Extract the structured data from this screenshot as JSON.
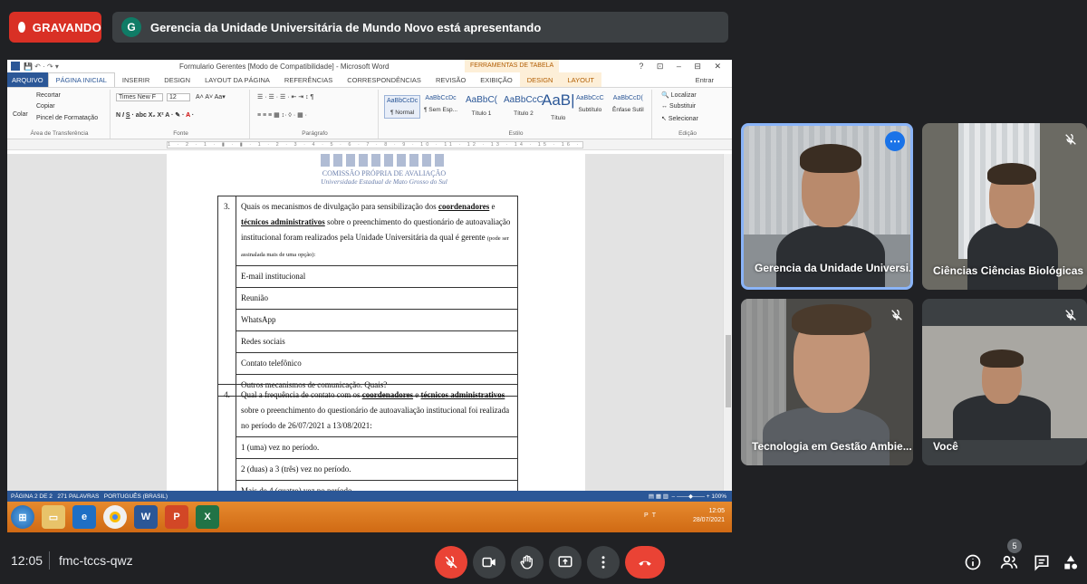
{
  "top": {
    "recording_label": "GRAVANDO",
    "presenter_initial": "G",
    "presenting_text": "Gerencia da Unidade Universitária de Mundo Novo está apresentando"
  },
  "word": {
    "title": "Formulario Gerentes [Modo de Compatibilidade] - Microsoft Word",
    "tool_tab": "FERRAMENTAS DE TABELA",
    "window_buttons": "? ⊡ – ⊟ ✕",
    "tabs": [
      "ARQUIVO",
      "PÁGINA INICIAL",
      "INSERIR",
      "DESIGN",
      "LAYOUT DA PÁGINA",
      "REFERÊNCIAS",
      "CORRESPONDÊNCIAS",
      "REVISÃO",
      "EXIBIÇÃO",
      "DESIGN",
      "LAYOUT"
    ],
    "signin": "Entrar",
    "ribbon": {
      "clipboard": {
        "paste": "Colar",
        "cut": "Recortar",
        "copy": "Copiar",
        "format_painter": "Pincel de Formatação",
        "label": "Área de Transferência"
      },
      "font": {
        "name": "Times New F",
        "size": "12",
        "label": "Fonte"
      },
      "paragraph": {
        "label": "Parágrafo"
      },
      "styles": {
        "label": "Estilo",
        "items": [
          {
            "sample": "AaBbCcDc",
            "name": "¶ Normal"
          },
          {
            "sample": "AaBbCcDc",
            "name": "¶ Sem Esp..."
          },
          {
            "sample": "AaBbC(",
            "name": "Título 1"
          },
          {
            "sample": "AaBbCcC",
            "name": "Título 2"
          },
          {
            "sample": "AaB|",
            "name": "Título"
          },
          {
            "sample": "AaBbCcC",
            "name": "Subtítulo"
          },
          {
            "sample": "AaBbCcD(",
            "name": "Ênfase Sutil"
          }
        ]
      },
      "editing": {
        "find": "Localizar",
        "replace": "Substituir",
        "select": "Selecionar",
        "label": "Edição"
      }
    },
    "ruler": "1 · 2 · 1 · ▮ · ▮ · 1 · 2 · 3 · 4 · 5 · 6 · 7 · 8 · 9 · 10 · 11 · 12 · 13 · 14 · 15 · 16 · 17",
    "logo_subtitle1": "COMISSÃO PRÓPRIA DE AVALIAÇÃO",
    "logo_subtitle2": "Universidade Estadual de Mato Grosso do Sul",
    "q3": {
      "number": "3.",
      "text_a": "Quais os mecanismos de divulgação para sensibilização dos ",
      "bold1": "coordenadores",
      "text_b": " e ",
      "bold2": "técnicos administrativos",
      "text_c": " sobre o preenchimento do questionário de autoavaliação institucional foram realizados pela Unidade Universitária da qual é gerente ",
      "note": "(pode ser assinalada mais de uma opção):",
      "options": [
        "E-mail institucional",
        "Reunião",
        "WhatsApp",
        "Redes sociais",
        "Contato telefônico",
        "Outros mecanismos de comunicação. Quais?"
      ]
    },
    "q4": {
      "number": "4.",
      "text_a": "Qual a frequência de contato com os ",
      "bold1": "coordenadores",
      "text_b": " e ",
      "bold2": "técnicos administrativos",
      "text_c": " sobre o preenchimento do questionário de autoavaliação institucional foi realizada no período de 26/07/2021 a 13/08/2021:",
      "options": [
        "1 (uma) vez no período.",
        "2 (duas) a 3 (três) vez no período.",
        "Mais de 4 (quatro) vez no período."
      ]
    },
    "status": {
      "page": "PÁGINA 2 DE 2",
      "words": "271 PALAVRAS",
      "lang": "PORTUGUÊS (BRASIL)",
      "zoom": "100%"
    },
    "taskbar": {
      "lang": "PT",
      "time": "12:05",
      "date": "28/07/2021"
    }
  },
  "participants": [
    {
      "name": "Gerencia da Unidade Universi..."
    },
    {
      "name": "Ciências Ciências Biológicas ..."
    },
    {
      "name": "Tecnologia em Gestão Ambie..."
    },
    {
      "name": "Você"
    }
  ],
  "bottom": {
    "time": "12:05",
    "meeting_code": "fmc-tccs-qwz",
    "people_count": "5"
  },
  "colors": {
    "recording": "#d93025",
    "meet_bg": "#202124",
    "word_blue": "#2b5797",
    "hangup": "#ea4335",
    "active_border": "#8ab4f8"
  }
}
